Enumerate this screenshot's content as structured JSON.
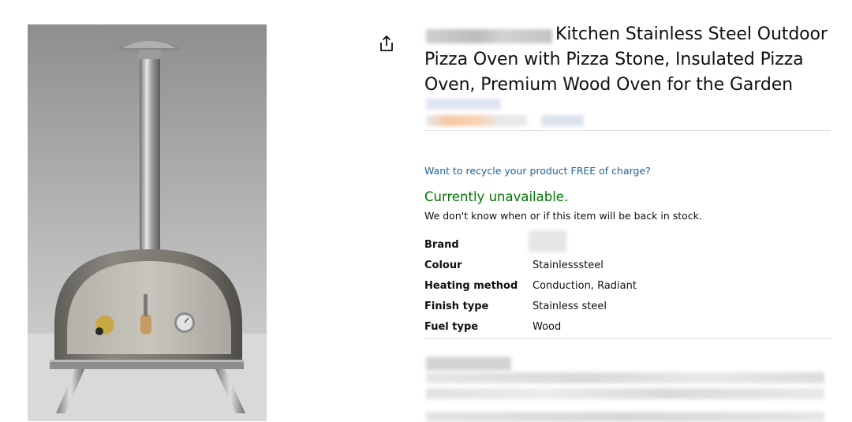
{
  "product": {
    "title_lines": [
      "Kitchen Stainless Steel Outdoor",
      "Pizza Oven with Pizza Stone, Insulated Pizza",
      "Oven, Premium Wood Oven for the Garden"
    ],
    "image_icon": "pizza-oven-photo"
  },
  "share": {
    "icon": "share-icon"
  },
  "recycle_link": "Want to recycle your product FREE of charge?",
  "availability": {
    "status": "Currently unavailable.",
    "note": "We don't know when or if this item will be back in stock.",
    "status_color": "#007600"
  },
  "specs": [
    {
      "label": "Brand",
      "value": ""
    },
    {
      "label": "Colour",
      "value": "Stainlesssteel"
    },
    {
      "label": "Heating method",
      "value": "Conduction, Radiant"
    },
    {
      "label": "Finish type",
      "value": "Stainless steel"
    },
    {
      "label": "Fuel type",
      "value": "Wood"
    }
  ],
  "colors": {
    "link": "#2162a1",
    "text": "#0f1111",
    "divider": "#dddddd"
  }
}
